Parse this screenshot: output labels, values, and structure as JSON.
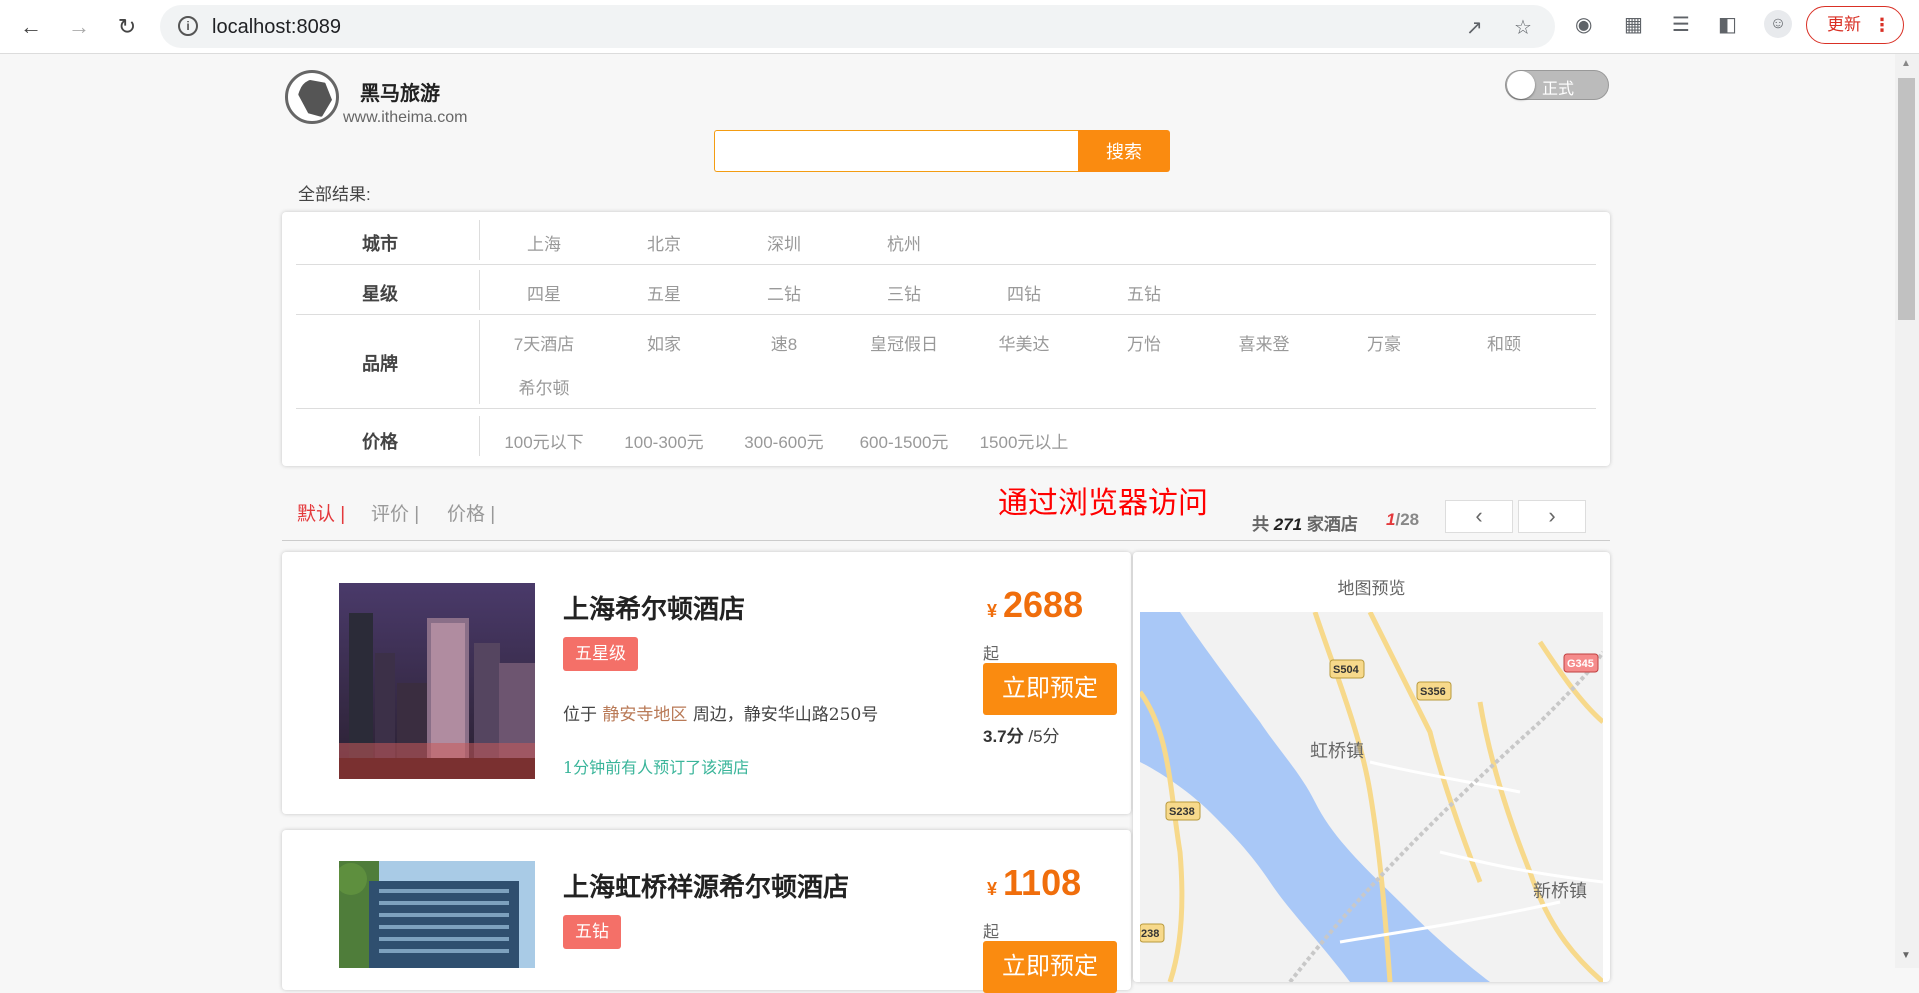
{
  "browser": {
    "url": "localhost:8089",
    "update_label": "更新"
  },
  "site": {
    "brand_name": "黑马旅游",
    "brand_url": "www.itheima.com",
    "toggle_label": "正式",
    "search": {
      "placeholder": "",
      "button": "搜索"
    },
    "all_results_label": "全部结果:"
  },
  "filters": {
    "city": {
      "label": "城市",
      "options": [
        "上海",
        "北京",
        "深圳",
        "杭州"
      ]
    },
    "star": {
      "label": "星级",
      "options": [
        "四星",
        "五星",
        "二钻",
        "三钻",
        "四钻",
        "五钻"
      ]
    },
    "brand": {
      "label": "品牌",
      "options": [
        "7天酒店",
        "如家",
        "速8",
        "皇冠假日",
        "华美达",
        "万怡",
        "喜来登",
        "万豪",
        "和颐",
        "希尔顿"
      ]
    },
    "price": {
      "label": "价格",
      "options": [
        "100元以下",
        "100-300元",
        "300-600元",
        "600-1500元",
        "1500元以上"
      ]
    }
  },
  "sort": {
    "options": [
      "默认 |",
      "评价 |",
      "价格 |"
    ],
    "active_index": 0
  },
  "annotation": "通过浏览器访问",
  "results": {
    "prefix": "共",
    "count": "271",
    "suffix": "家酒店",
    "page_current": "1",
    "page_total": "/28",
    "prev": "‹",
    "next": "›"
  },
  "hotels": [
    {
      "name": "上海希尔顿酒店",
      "tag": "五星级",
      "addr_prefix": "位于",
      "area": "静安寺地区",
      "addr_rest": "周边，静安华山路250号",
      "booked": "1分钟前有人预订了该酒店",
      "yen": "¥",
      "price": "2688",
      "qi": "起",
      "book": "立即预定",
      "score": "3.7分",
      "score_max": "/5分"
    },
    {
      "name": "上海虹桥祥源希尔顿酒店",
      "tag": "五钻",
      "yen": "¥",
      "price": "1108",
      "qi": "起",
      "book": "立即预定"
    }
  ],
  "map": {
    "title": "地图预览",
    "labels": [
      "虹桥镇",
      "新桥镇",
      "S504",
      "S356",
      "G345",
      "S238",
      "238"
    ]
  },
  "colors": {
    "accent_orange": "#fa8b10",
    "price_orange": "#f06e0c",
    "active_red": "#e4393c",
    "tag_red": "#f47068",
    "booked_green": "#3ab59a",
    "annotation_red": "#ff0000"
  }
}
